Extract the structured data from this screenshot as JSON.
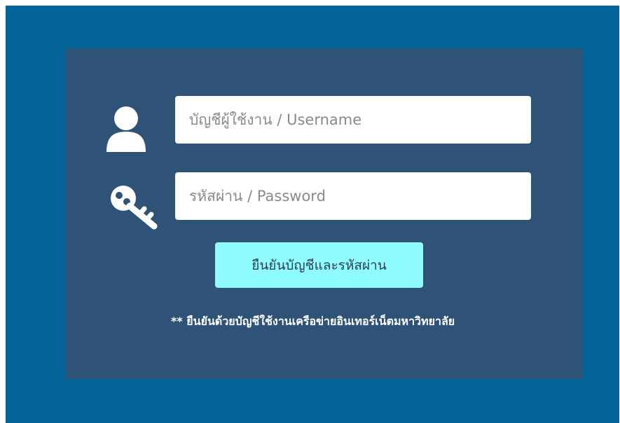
{
  "login": {
    "username_placeholder": "บัญชีผู้ใช้งาน / Username",
    "password_placeholder": "รหัสผ่าน / Password",
    "submit_label": "ยืนยันบัญชีและรหัสผ่าน",
    "note": "** ยืนยันด้วยบัญชีใช้งานเครือข่ายอินเทอร์เน็ตมหาวิทยาลัย"
  },
  "icons": {
    "user": "user-icon",
    "key": "key-icon"
  },
  "colors": {
    "frame_background": "#04649a",
    "panel_background": "#2f5377",
    "button_background": "#8ffcff",
    "button_text": "#2b3e57",
    "field_background": "#ffffff",
    "icon_color": "#ffffff"
  }
}
